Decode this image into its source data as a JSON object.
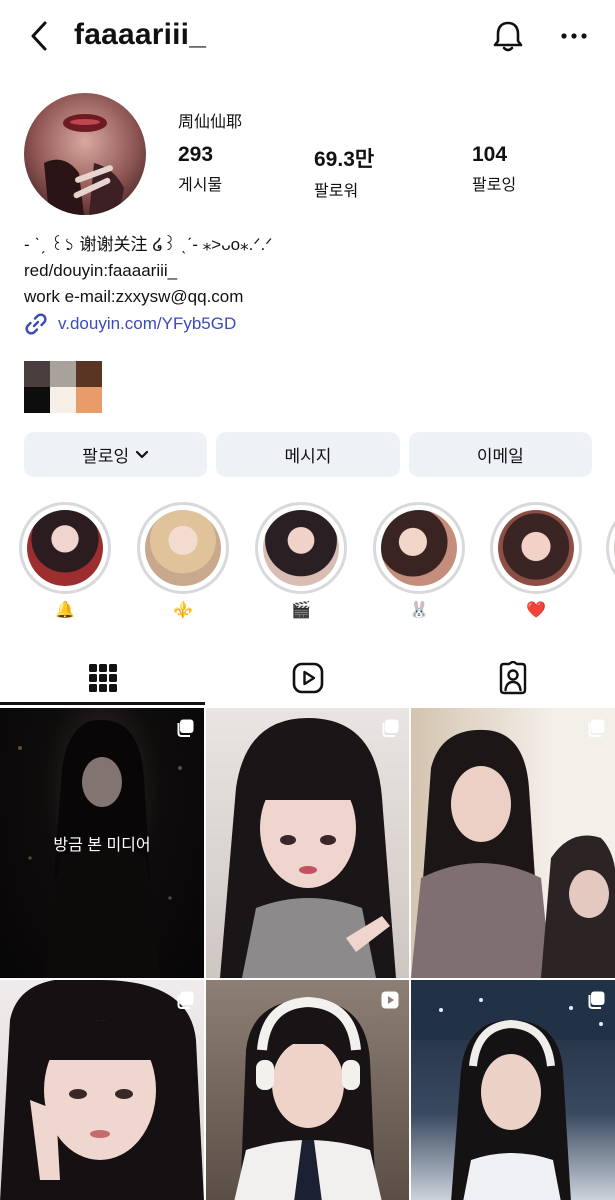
{
  "header": {
    "username": "faaaariii_",
    "back_icon": "chevron-left-icon",
    "bell_icon": "bell-icon",
    "more_icon": "more-horizontal-icon"
  },
  "profile": {
    "display_name": "周仙仙耶",
    "stats": [
      {
        "value": "293",
        "label": "게시물"
      },
      {
        "value": "69.3만",
        "label": "팔로워"
      },
      {
        "value": "104",
        "label": "팔로잉"
      }
    ],
    "bio_lines": [
      "- ˋˏ ꒰১ 谢谢关注 ໒꒱ ˎˊ- ⁎>ᴗo⁎.ᐟ.ᐟ",
      "red/douyin:faaaariii_",
      "work e-mail:zxxysw@qq.com"
    ],
    "link": "v.douyin.com/YFyb5GD",
    "swatch_colors": [
      "#4a3e3f",
      "#a8a29a",
      "#5a3524",
      "#0e0d0d",
      "#f6efe7",
      "#e79c69"
    ]
  },
  "actions": {
    "following_label": "팔로잉",
    "message_label": "메시지",
    "email_label": "이메일"
  },
  "highlights": [
    {
      "label": "🔔"
    },
    {
      "label": "⚜️"
    },
    {
      "label": "🎬"
    },
    {
      "label": "🐰"
    },
    {
      "label": "❤️"
    }
  ],
  "tabs": {
    "grid_icon": "grid-icon",
    "reels_icon": "reels-icon",
    "tagged_icon": "tagged-icon"
  },
  "posts": [
    {
      "overlay": "방금 본 미디어",
      "type": "carousel"
    },
    {
      "overlay": "",
      "type": "carousel"
    },
    {
      "overlay": "",
      "type": "carousel"
    },
    {
      "overlay": "",
      "type": "carousel"
    },
    {
      "overlay": "",
      "type": "reel"
    },
    {
      "overlay": "",
      "type": "carousel"
    }
  ],
  "colors": {
    "link": "#3b4bb8",
    "button_bg": "#eef1f5",
    "ring": "#d8d9dc"
  }
}
